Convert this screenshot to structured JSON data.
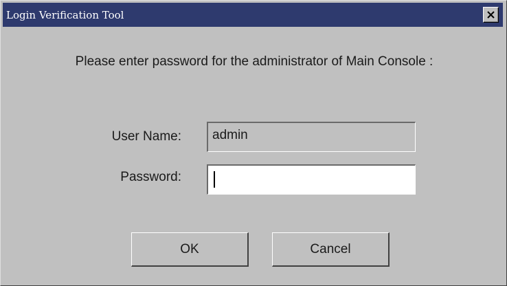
{
  "window": {
    "title": "Login Verification Tool"
  },
  "prompt": "Please enter password for the administrator of Main Console :",
  "form": {
    "username_label": "User Name:",
    "username_value": "admin",
    "password_label": "Password:",
    "password_value": ""
  },
  "buttons": {
    "ok_label": "OK",
    "cancel_label": "Cancel"
  },
  "colors": {
    "titlebar": "#2e3a6e",
    "dialog_bg": "#c0c0c0",
    "field_bg": "#ffffff"
  },
  "icons": {
    "close": "close-icon"
  }
}
